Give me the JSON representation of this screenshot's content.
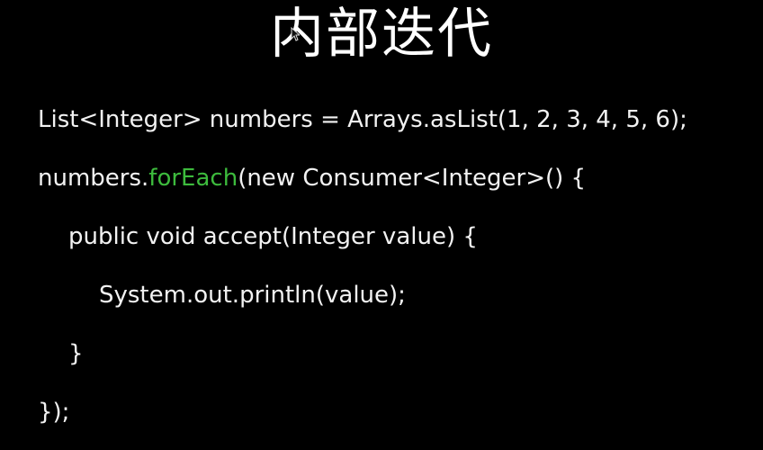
{
  "slide": {
    "title": "内部迭代",
    "code_lines": [
      {
        "text": "List<Integer> numbers = Arrays.asList(1, 2, 3, 4, 5, 6);"
      },
      {
        "before": "numbers.",
        "highlight": "forEach",
        "after": "(new Consumer<Integer>() {"
      },
      {
        "text": "public void accept(Integer value) {"
      },
      {
        "text": "System.out.println(value);"
      },
      {
        "text": "}"
      },
      {
        "text": "});"
      }
    ]
  },
  "colors": {
    "background": "#000000",
    "text": "#f2f2f2",
    "highlight": "#3dbb3d"
  },
  "icons": {
    "cursor": "mouse-pointer-icon"
  }
}
